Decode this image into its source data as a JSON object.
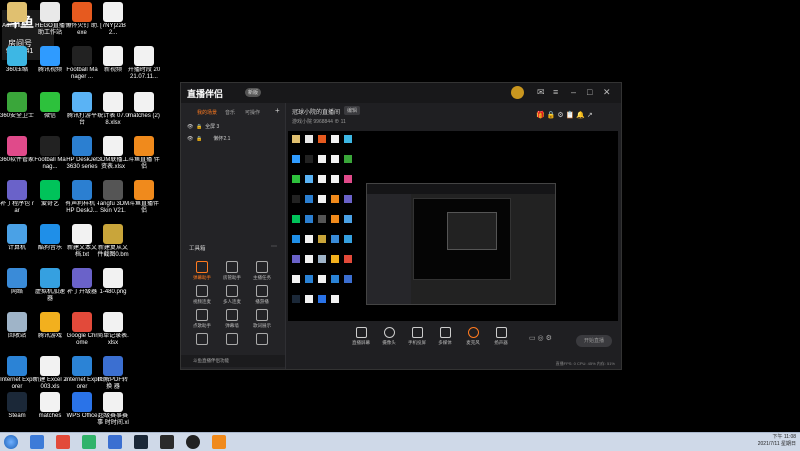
{
  "desktop": {
    "watermark": {
      "line1": "斗鱼",
      "line2": "房间号",
      "line3": "9968841"
    },
    "icons": [
      {
        "label": "Administr...",
        "color": "#e0c070"
      },
      {
        "label": "HEGO直播\n助工作站",
        "color": "#e9e9e9"
      },
      {
        "label": "懒怀火钉\n助.exe",
        "color": "#e65a1f"
      },
      {
        "label": "[7NY]22B2...",
        "color": "#f2f2f2"
      },
      {
        "label": "360压缩",
        "color": "#3db7e4"
      },
      {
        "label": "腾讯视频",
        "color": "#2f9bff"
      },
      {
        "label": "Football\nManager ...",
        "color": "#222"
      },
      {
        "label": "新视频",
        "color": "#f2f2f2"
      },
      {
        "label": "开播时段\n2021.07.11...",
        "color": "#f2f2f2"
      },
      {
        "label": "360安全卫士",
        "color": "#3aa63a"
      },
      {
        "label": "微信",
        "color": "#2dc13c"
      },
      {
        "label": "腾讯打游平台",
        "color": "#5ab3f5"
      },
      {
        "label": "统计表\n07.08.xlsx",
        "color": "#f2f2f2"
      },
      {
        "label": "matches (2)",
        "color": "#f2f2f2"
      },
      {
        "label": "360软件管家",
        "color": "#e04a8a"
      },
      {
        "label": "Football\nManag...",
        "color": "#222"
      },
      {
        "label": "HP DeskJet\n3630 series",
        "color": "#2b7fd1"
      },
      {
        "label": "3DM联播工\n资表.xlsx",
        "color": "#f2f2f2"
      },
      {
        "label": "斗鱼直播\n伴侣",
        "color": "#f08a1c"
      },
      {
        "label": "补丁程序包\nrar",
        "color": "#6a62c9"
      },
      {
        "label": "爱奇艺",
        "color": "#00c35a"
      },
      {
        "label": "有声利样机\n- HP DeskJ...",
        "color": "#2b7fd1"
      },
      {
        "label": "Tangfu 3DM\nSkin V21.0...",
        "color": "#555"
      },
      {
        "label": "斗鱼直播伴\n侣",
        "color": "#f08a1c"
      },
      {
        "label": "计算机",
        "color": "#4aa1e6"
      },
      {
        "label": "酷狗音乐",
        "color": "#1f8fe8"
      },
      {
        "label": "新建文本文\n档.txt",
        "color": "#f2f2f2"
      },
      {
        "label": "新建复从文\n件截图0.bmp",
        "color": "#c9a53a"
      },
      {
        "label": "网络",
        "color": "#3a8bd8"
      },
      {
        "label": "虚拟机加速器",
        "color": "#35a0e0"
      },
      {
        "label": "补丁升级器",
        "color": "#6a62c9"
      },
      {
        "label": "1-480.png",
        "color": "#f2f2f2"
      },
      {
        "label": "回收站",
        "color": "#9fb4c8"
      },
      {
        "label": "腾讯游戏",
        "color": "#f2b01e"
      },
      {
        "label": "Google\nChrome",
        "color": "#e24a3a"
      },
      {
        "label": "简单记录表.\nxlsx",
        "color": "#f2f2f2"
      },
      {
        "label": "Internet\nExplorer",
        "color": "#2b83d6"
      },
      {
        "label": "新建 Excel\n2003.xls",
        "color": "#f2f2f2"
      },
      {
        "label": "Internet\nExplorer",
        "color": "#2b83d6"
      },
      {
        "label": "图解PDF转换\n器",
        "color": "#3b6fd1"
      },
      {
        "label": "Steam",
        "color": "#1b2838"
      },
      {
        "label": "matches",
        "color": "#f2f2f2"
      },
      {
        "label": "WPS Office",
        "color": "#2a73e8"
      },
      {
        "label": "超级赛事赛事\n时时间.xls",
        "color": "#f2f2f2"
      }
    ]
  },
  "window": {
    "logo": "直播伴侣",
    "badge": "新版",
    "left_tabs": [
      "我的场景",
      "音乐",
      "可操作"
    ],
    "scenes": [
      {
        "name": "全屏 3"
      },
      {
        "name": "懒怀2.1"
      }
    ],
    "tools_title": "工具箱",
    "tools": [
      "弹幕助手",
      "房管助手",
      "主播任务",
      "视频连麦",
      "多人连麦",
      "播游播",
      "点歌助手",
      "弹幕墙",
      "歌词展示",
      "",
      "",
      ""
    ],
    "notice": "斗鱼直播伴侣功能",
    "room_title": "冠球小院的直播间",
    "room_tag": "编辑",
    "room_sub": "游戏小院  9968844  ⊕ 11",
    "bottom_tools": [
      "直播屏幕",
      "摄像头",
      "手机投屏",
      "多媒体",
      "麦克风",
      "扬声器"
    ],
    "start_btn": "开始直播",
    "status": "直播FPS: 0    CPU: 45%    内存: 51%"
  },
  "taskbar": {
    "time": "下午 11:08",
    "date": "2021/7/11 星期日"
  }
}
